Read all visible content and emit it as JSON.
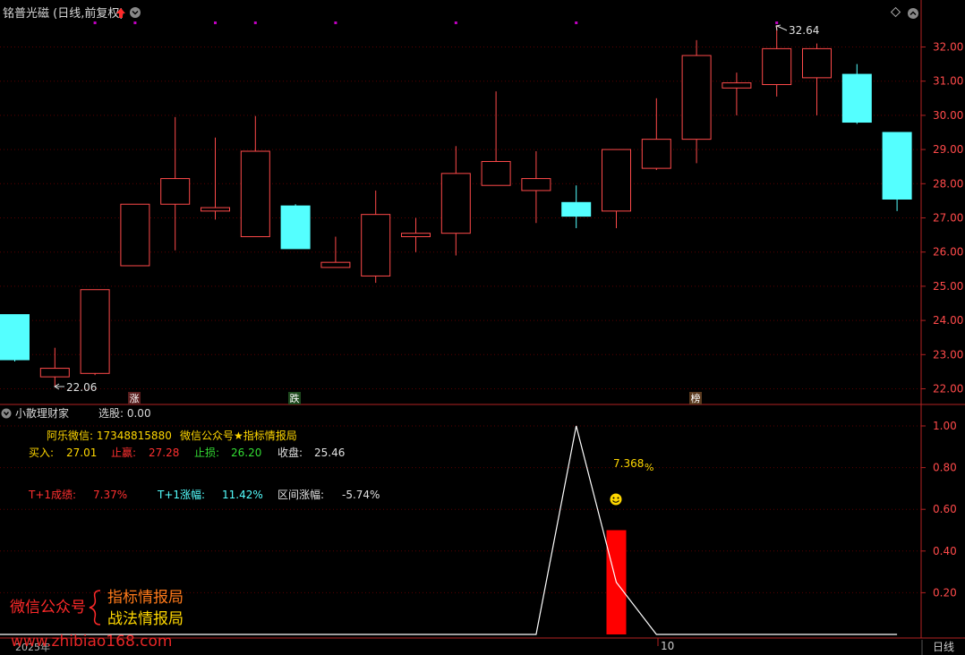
{
  "header": {
    "stock_title": "铭普光磁 (日线,前复权)",
    "sub_panel_title": "小散理财家",
    "sub_panel_select_label": "选股: 0.00"
  },
  "colors": {
    "up": "#ff4a4a",
    "down": "#54ffff",
    "grid": "#5a0000",
    "axis": "#b22222",
    "marker": "#c000c0"
  },
  "main_chart": {
    "y_ticks": [
      "32.00",
      "31.00",
      "30.00",
      "29.00",
      "28.00",
      "27.00",
      "26.00",
      "25.00",
      "24.00",
      "23.00",
      "22.00"
    ],
    "high_label": "32.64",
    "low_label": "22.06",
    "events": [
      "涨",
      "跌",
      "榜"
    ]
  },
  "sub_chart": {
    "y_ticks": [
      "1.00",
      "0.80",
      "0.60",
      "0.40",
      "0.20"
    ],
    "bar_value_label": "7.368",
    "bar_unit": "%",
    "x_label_year": "2025年",
    "x_label_month": "10",
    "period_button": "日线"
  },
  "info": {
    "contact_label": "阿乐微信: 17348815880",
    "account_label": "微信公众号★指标情报局",
    "buy_label": "买入:",
    "buy_value": "27.01",
    "tp_label": "止赢:",
    "tp_value": "27.28",
    "sl_label": "止损:",
    "sl_value": "26.20",
    "close_label": "收盘:",
    "close_value": "25.46",
    "t1_result_label": "T+1成绩:",
    "t1_result_value": "7.37%",
    "t1_change_label": "T+1涨幅:",
    "t1_change_value": "11.42%",
    "range_label": "区间涨幅:",
    "range_value": "-5.74%"
  },
  "watermark": {
    "left_text": "微信公众号",
    "line1": "指标情报局",
    "line2": "战法情报局",
    "url": "www.zhibiao168.com"
  },
  "chart_data": {
    "type": "candlestick",
    "ylim": [
      21.7,
      32.7
    ],
    "candles": [
      {
        "o": 24.17,
        "c": 22.85,
        "h": 24.17,
        "l": 22.8
      },
      {
        "o": 22.35,
        "c": 22.6,
        "h": 23.2,
        "l": 22.06
      },
      {
        "o": 22.45,
        "c": 24.9,
        "h": 24.9,
        "l": 22.4
      },
      {
        "o": 25.6,
        "c": 27.4,
        "h": 27.4,
        "l": 25.6
      },
      {
        "o": 27.4,
        "c": 28.15,
        "h": 29.95,
        "l": 26.05
      },
      {
        "o": 27.2,
        "c": 27.3,
        "h": 29.35,
        "l": 26.95
      },
      {
        "o": 26.45,
        "c": 28.95,
        "h": 29.98,
        "l": 26.45
      },
      {
        "o": 27.35,
        "c": 26.1,
        "h": 27.4,
        "l": 26.1
      },
      {
        "o": 25.55,
        "c": 25.7,
        "h": 26.45,
        "l": 25.55
      },
      {
        "o": 25.3,
        "c": 27.1,
        "h": 27.8,
        "l": 25.1
      },
      {
        "o": 26.45,
        "c": 26.55,
        "h": 27.0,
        "l": 26.0
      },
      {
        "o": 26.55,
        "c": 28.3,
        "h": 29.1,
        "l": 25.9
      },
      {
        "o": 27.95,
        "c": 28.65,
        "h": 30.7,
        "l": 27.95
      },
      {
        "o": 27.8,
        "c": 28.15,
        "h": 28.95,
        "l": 26.85
      },
      {
        "o": 27.45,
        "c": 27.05,
        "h": 27.95,
        "l": 26.7
      },
      {
        "o": 27.2,
        "c": 29.0,
        "h": 29.0,
        "l": 26.7
      },
      {
        "o": 28.45,
        "c": 29.3,
        "h": 30.5,
        "l": 28.4
      },
      {
        "o": 29.3,
        "c": 31.75,
        "h": 32.2,
        "l": 28.6
      },
      {
        "o": 30.8,
        "c": 30.95,
        "h": 31.25,
        "l": 30.0
      },
      {
        "o": 30.9,
        "c": 31.95,
        "h": 32.64,
        "l": 30.55
      },
      {
        "o": 31.1,
        "c": 31.95,
        "h": 32.1,
        "l": 30.0
      },
      {
        "o": 31.2,
        "c": 29.8,
        "h": 31.5,
        "l": 29.75
      },
      {
        "o": 29.5,
        "c": 27.55,
        "h": 29.5,
        "l": 27.2
      }
    ],
    "indicator_line": [
      0,
      0,
      0,
      0,
      0,
      0,
      0,
      0,
      0,
      0,
      0,
      0,
      0,
      0,
      1.0,
      0.25,
      0,
      0,
      0,
      0,
      0,
      0,
      0
    ],
    "indicator_bar": {
      "index": 15,
      "value": 0.5
    }
  }
}
